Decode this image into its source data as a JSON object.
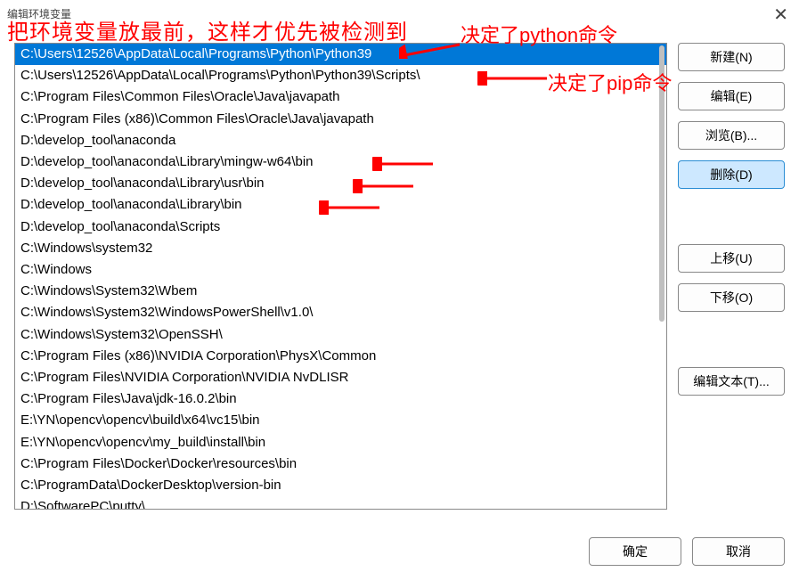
{
  "window": {
    "title": "编辑环境变量"
  },
  "annotations": {
    "top": "把环境变量放最前，这样才优先被检测到",
    "python": "决定了python命令",
    "pip": "决定了pip命令"
  },
  "paths": [
    "C:\\Users\\12526\\AppData\\Local\\Programs\\Python\\Python39",
    "C:\\Users\\12526\\AppData\\Local\\Programs\\Python\\Python39\\Scripts\\",
    "C:\\Program Files\\Common Files\\Oracle\\Java\\javapath",
    "C:\\Program Files (x86)\\Common Files\\Oracle\\Java\\javapath",
    "D:\\develop_tool\\anaconda",
    "D:\\develop_tool\\anaconda\\Library\\mingw-w64\\bin",
    "D:\\develop_tool\\anaconda\\Library\\usr\\bin",
    "D:\\develop_tool\\anaconda\\Library\\bin",
    "D:\\develop_tool\\anaconda\\Scripts",
    "C:\\Windows\\system32",
    "C:\\Windows",
    "C:\\Windows\\System32\\Wbem",
    "C:\\Windows\\System32\\WindowsPowerShell\\v1.0\\",
    "C:\\Windows\\System32\\OpenSSH\\",
    "C:\\Program Files (x86)\\NVIDIA Corporation\\PhysX\\Common",
    "C:\\Program Files\\NVIDIA Corporation\\NVIDIA NvDLISR",
    "C:\\Program Files\\Java\\jdk-16.0.2\\bin",
    "E:\\YN\\opencv\\opencv\\build\\x64\\vc15\\bin",
    "E:\\YN\\opencv\\opencv\\my_build\\install\\bin",
    "C:\\Program Files\\Docker\\Docker\\resources\\bin",
    "C:\\ProgramData\\DockerDesktop\\version-bin",
    "D:\\SoftwarePC\\putty\\"
  ],
  "selected_index": 0,
  "buttons": {
    "new": "新建(N)",
    "edit": "编辑(E)",
    "browse": "浏览(B)...",
    "delete": "删除(D)",
    "moveup": "上移(U)",
    "movedown": "下移(O)",
    "edittext": "编辑文本(T)...",
    "ok": "确定",
    "cancel": "取消"
  }
}
